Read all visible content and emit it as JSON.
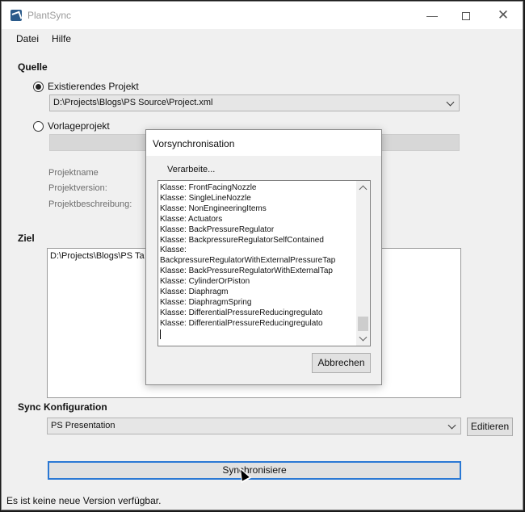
{
  "window": {
    "title": "PlantSync",
    "min_glyph": "—",
    "close_glyph": "✕"
  },
  "menu": {
    "datei": "Datei",
    "hilfe": "Hilfe"
  },
  "quelle": {
    "label": "Quelle",
    "existing_radio": "Existierendes Projekt",
    "existing_checked": true,
    "existing_path": "D:\\Projects\\Blogs\\PS Source\\Project.xml",
    "template_radio": "Vorlageprojekt",
    "template_checked": false,
    "projektname": "Projektname",
    "projektversion": "Projektversion:",
    "projektbeschreibung": "Projektbeschreibung:"
  },
  "ziel": {
    "label": "Ziel",
    "path": "D:\\Projects\\Blogs\\PS Ta"
  },
  "sync": {
    "label": "Sync Konfiguration",
    "selected": "PS Presentation",
    "edit_button": "Editieren",
    "sync_button": "Synchronisiere"
  },
  "status_bar": "Es ist keine neue Version verfügbar.",
  "dialog": {
    "title": "Vorsynchronisation",
    "status": "Verarbeite...",
    "lines": [
      "Klasse: FrontFacingNozzle",
      "Klasse: SingleLineNozzle",
      "Klasse: NonEngineeringItems",
      "Klasse: Actuators",
      "Klasse: BackPressureRegulator",
      "Klasse: BackpressureRegulatorSelfContained",
      "Klasse:",
      "BackpressureRegulatorWithExternalPressureTap",
      "Klasse: BackPressureRegulatorWithExternalTap",
      "Klasse: CylinderOrPiston",
      "Klasse: Diaphragm",
      "Klasse: DiaphragmSpring",
      "Klasse: DifferentialPressureReducingregulato",
      "Klasse: DifferentialPressureReducingregulato"
    ],
    "cancel_button": "Abbrechen"
  },
  "colors": {
    "accent": "#2a78d4",
    "window_bg": "#f0f0f0",
    "titlebar_bg": "#ffffff"
  }
}
